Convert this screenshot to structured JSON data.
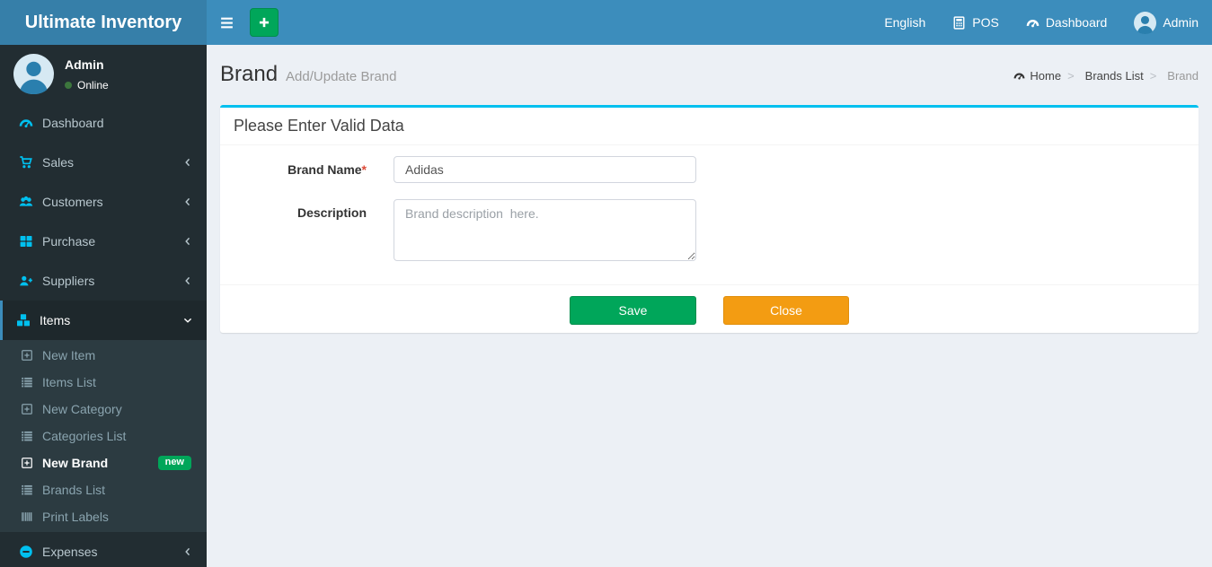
{
  "app": {
    "title": "Ultimate Inventory"
  },
  "navbar": {
    "right_items": [
      {
        "label": "English"
      },
      {
        "label": "POS",
        "icon": "calculator-icon"
      },
      {
        "label": "Dashboard",
        "icon": "dashboard-icon"
      },
      {
        "label": "Admin",
        "icon": "user-avatar-icon"
      }
    ]
  },
  "sidebar": {
    "user": {
      "name": "Admin",
      "status": "Online"
    },
    "menu": [
      {
        "label": "Dashboard",
        "icon": "dashboard-icon"
      },
      {
        "label": "Sales",
        "icon": "cart-icon",
        "chevron": "angle-left-icon"
      },
      {
        "label": "Customers",
        "icon": "users-icon",
        "chevron": "angle-left-icon"
      },
      {
        "label": "Purchase",
        "icon": "grid-icon",
        "chevron": "angle-left-icon"
      },
      {
        "label": "Suppliers",
        "icon": "user-plus-icon",
        "chevron": "angle-left-icon"
      },
      {
        "label": "Items",
        "icon": "cubes-icon",
        "chevron": "angle-down-icon",
        "active": true
      }
    ],
    "submenu": [
      {
        "label": "New Item",
        "icon": "plus-square-icon"
      },
      {
        "label": "Items List",
        "icon": "list-icon"
      },
      {
        "label": "New Category",
        "icon": "plus-square-icon"
      },
      {
        "label": "Categories List",
        "icon": "list-icon"
      },
      {
        "label": "New Brand",
        "icon": "plus-square-icon",
        "active": true,
        "badge": "new"
      },
      {
        "label": "Brands List",
        "icon": "list-icon"
      },
      {
        "label": "Print Labels",
        "icon": "barcode-icon"
      }
    ],
    "menu_bottom": [
      {
        "label": "Expenses",
        "icon": "minus-circle-icon",
        "chevron": "angle-left-icon"
      }
    ]
  },
  "page": {
    "title": "Brand",
    "subtitle": "Add/Update Brand",
    "breadcrumb": [
      {
        "label": "Home",
        "icon": "dashboard-icon"
      },
      {
        "label": "Brands List"
      },
      {
        "label": "Brand",
        "active": true,
        "interactable": false
      }
    ]
  },
  "form": {
    "panel_title": "Please Enter Valid Data",
    "brand_name": {
      "label": "Brand Name",
      "required_mark": "*",
      "value": "Adidas"
    },
    "description": {
      "label": "Description",
      "placeholder": "Brand description  here."
    },
    "save_label": "Save",
    "close_label": "Close"
  },
  "colors": {
    "navbar-bg": "#3c8dbc",
    "logo-bg": "#367fa9",
    "sidebar-bg": "#222d32",
    "submenu-bg": "#2c3b41",
    "active-item-bg": "#1e282c",
    "active-border": "#3c8dbc",
    "icon-accent": "#00c0ef",
    "panel-top": "#00c0ef",
    "success": "#00a65a",
    "success-border": "#008d4c",
    "warning": "#f39c12",
    "warning-border": "#e08e0b",
    "content-bg": "#ecf0f5",
    "sidebar-text": "#b8c7ce",
    "submenu-text": "#8aa4af",
    "online-dot": "#3c763d"
  }
}
